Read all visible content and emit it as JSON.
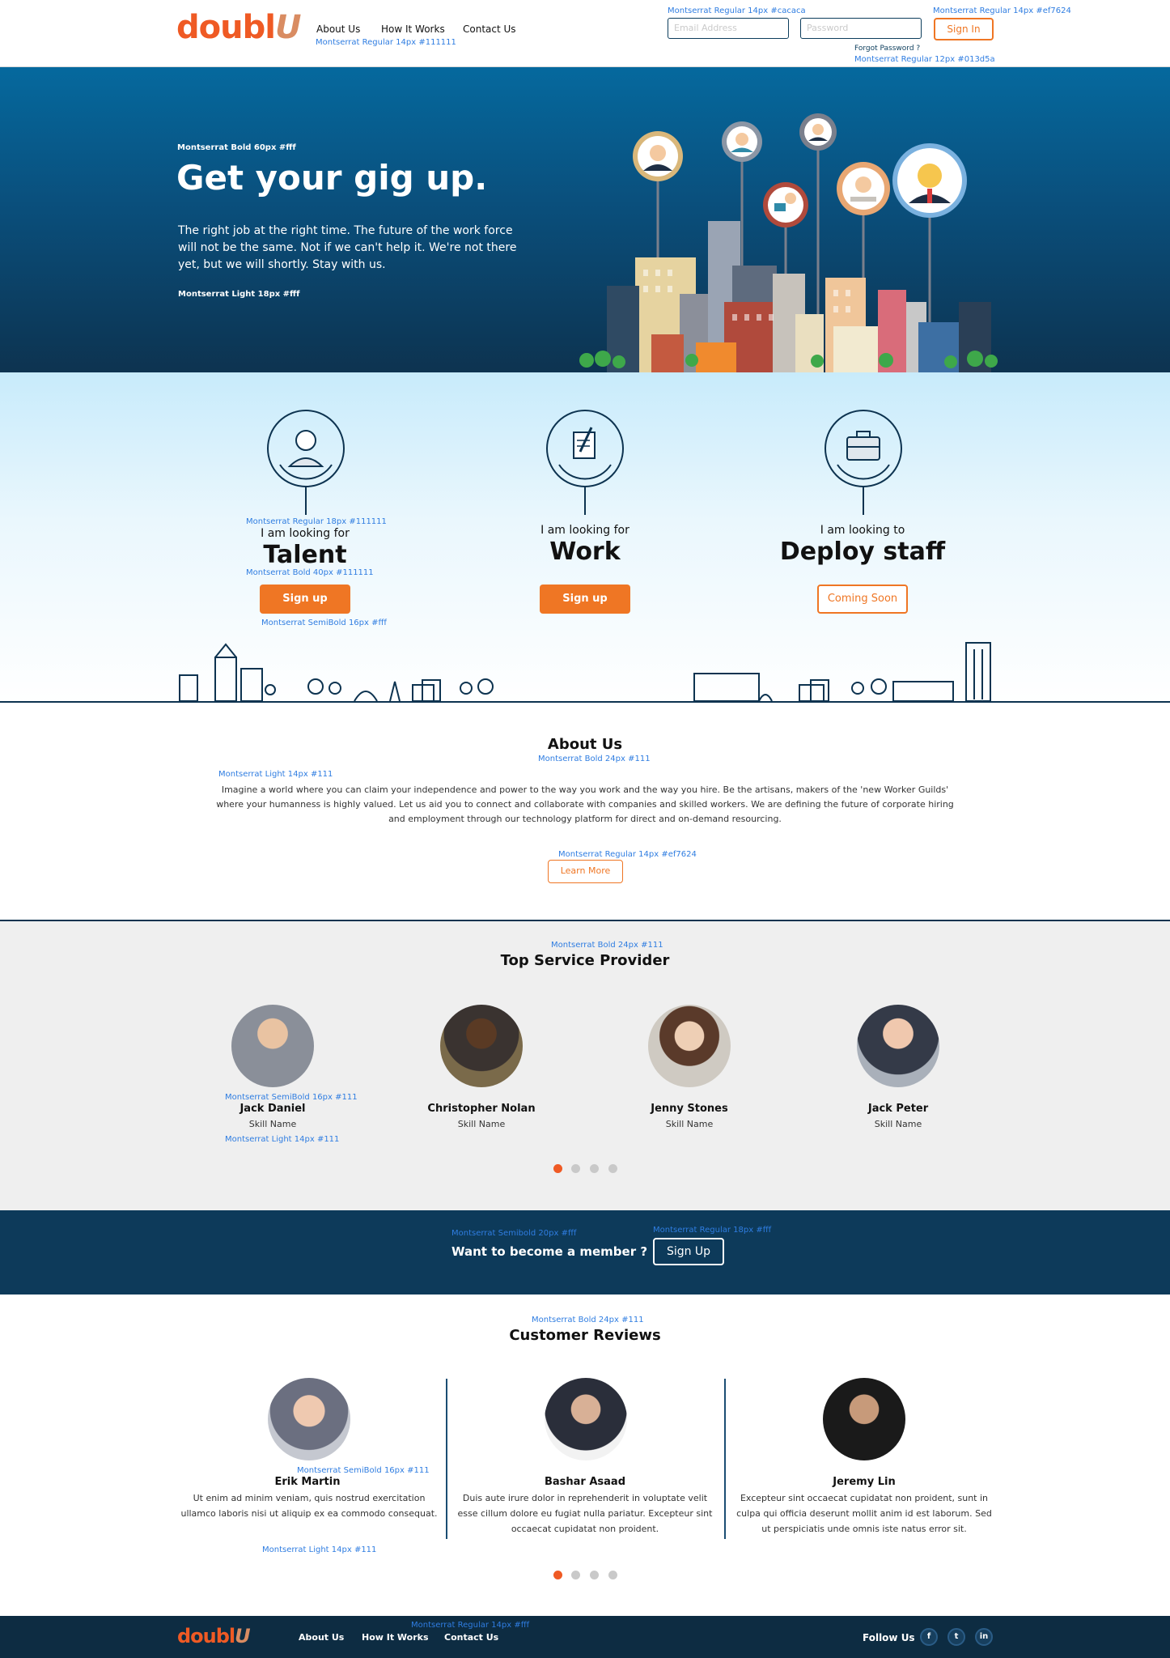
{
  "brand": {
    "logo_main": "doubl",
    "logo_u": "U"
  },
  "header": {
    "nav": [
      "About Us",
      "How It Works",
      "Contact Us"
    ],
    "nav_spec": "Montserrat Regular 14px #111111",
    "email_placeholder": "Email Address",
    "password_placeholder": "Password",
    "input_spec": "Montserrat Regular 14px #cacaca",
    "signin_label": "Sign In",
    "signin_spec": "Montserrat Regular 14px #ef7624",
    "forgot_label": "Forgot Password ?",
    "forgot_spec": "Montserrat Regular 12px #013d5a"
  },
  "hero": {
    "title_spec": "Montserrat Bold 60px #fff",
    "title": "Get your gig up.",
    "body": "The right job at the right time. The future of the work force will not be the same. Not if we can't help it. We're not there yet, but we will shortly. Stay with us.",
    "body_spec": "Montserrat Light 18px #fff"
  },
  "choices": {
    "lead_spec": "Montserrat Regular 18px #111111",
    "big_spec": "Montserrat Bold 40px #111111",
    "button_spec": "Montserrat SemiBold 16px #fff",
    "items": [
      {
        "lead": "I am looking for",
        "big": "Talent",
        "button": "Sign up"
      },
      {
        "lead": "I am looking for",
        "big": "Work",
        "button": "Sign up"
      },
      {
        "lead": "I am looking to",
        "big": "Deploy staff",
        "button": "Coming Soon"
      }
    ]
  },
  "about": {
    "title": "About Us",
    "title_spec": "Montserrat Bold 24px #111",
    "body_spec": "Montserrat Light 14px #111",
    "body": "Imagine a world where you can claim your independence and power to the way you work and the way you hire. Be the artisans, makers of the 'new Worker Guilds' where your humanness is highly valued. Let us aid you to connect and collaborate with companies and skilled workers. We are defining the future of corporate hiring and employment through our technology platform for direct and on-demand resourcing.",
    "button_spec": "Montserrat Regular 14px #ef7624",
    "button": "Learn More"
  },
  "providers": {
    "title_spec": "Montserrat Bold 24px #111",
    "title": "Top Service Provider",
    "name_spec": "Montserrat SemiBold 16px #111",
    "skill_spec": "Montserrat Light 14px #111",
    "items": [
      {
        "name": "Jack Daniel",
        "skill": "Skill Name"
      },
      {
        "name": "Christopher Nolan",
        "skill": "Skill Name"
      },
      {
        "name": "Jenny Stones",
        "skill": "Skill Name"
      },
      {
        "name": "Jack Peter",
        "skill": "Skill Name"
      }
    ],
    "active_page": 1,
    "page_count": 4
  },
  "member": {
    "text_spec": "Montserrat Semibold 20px #fff",
    "text": "Want to become a member ?",
    "button_spec": "Montserrat Regular 18px #fff",
    "button": "Sign Up"
  },
  "reviews": {
    "title_spec": "Montserrat Bold 24px #111",
    "title": "Customer Reviews",
    "name_spec": "Montserrat SemiBold 16px #111",
    "text_spec": "Montserrat Light 14px #111",
    "items": [
      {
        "name": "Erik Martin",
        "text": "Ut enim ad minim veniam, quis nostrud exercitation ullamco laboris nisi ut aliquip ex ea commodo consequat."
      },
      {
        "name": "Bashar Asaad",
        "text": "Duis aute irure dolor in reprehenderit in voluptate velit esse cillum dolore eu fugiat nulla pariatur. Excepteur sint occaecat cupidatat non proident."
      },
      {
        "name": "Jeremy Lin",
        "text": "Excepteur sint occaecat cupidatat non proident, sunt in culpa qui officia deserunt mollit anim id est laborum. Sed ut perspiciatis unde omnis iste natus error sit."
      }
    ],
    "active_page": 1,
    "page_count": 4
  },
  "footer": {
    "nav": [
      "About Us",
      "How It Works",
      "Contact Us"
    ],
    "nav_spec": "Montserrat Regular 14px #fff",
    "follow": "Follow Us",
    "social": [
      "facebook-icon",
      "twitter-icon",
      "linkedin-icon"
    ]
  },
  "colors": {
    "accent": "#ef7624",
    "brand_orange": "#ef5a24",
    "navy": "#0d3a5a",
    "hero_top": "#05699e",
    "spec_blue": "#2f7de1"
  }
}
